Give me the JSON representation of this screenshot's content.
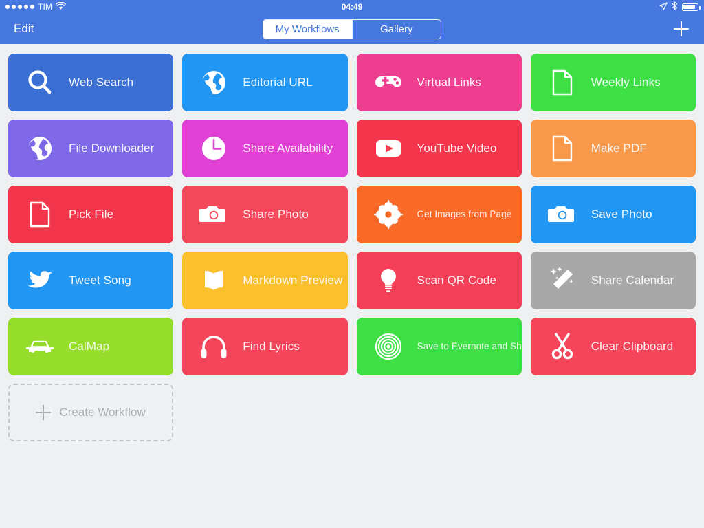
{
  "status_bar": {
    "signal_dots": 5,
    "carrier": "TIM",
    "wifi_icon": "wifi-icon",
    "time": "04:49",
    "location_icon": "location-arrow-icon",
    "bluetooth_icon": "bluetooth-icon",
    "battery_icon": "battery-icon"
  },
  "nav": {
    "edit_label": "Edit",
    "add_icon": "plus-icon",
    "segments": [
      {
        "label": "My Workflows",
        "active": true
      },
      {
        "label": "Gallery",
        "active": false
      }
    ]
  },
  "colors": {
    "nav_bar": "#4778e0",
    "page_background": "#eff0f2",
    "create_border": "#c3c7cd",
    "create_text": "#a9aeb5"
  },
  "workflows": [
    {
      "label": "Web Search",
      "icon": "magnifier-icon",
      "color": "#3b6fd4",
      "small": false
    },
    {
      "label": "Editorial URL",
      "icon": "globe-icon",
      "color": "#2196f3",
      "small": false
    },
    {
      "label": "Virtual Links",
      "icon": "gamepad-icon",
      "color": "#ed3e8f",
      "small": false
    },
    {
      "label": "Weekly Links",
      "icon": "document-icon",
      "color": "#3ee046",
      "small": false
    },
    {
      "label": "File Downloader",
      "icon": "globe-icon",
      "color": "#8069e8",
      "small": false
    },
    {
      "label": "Share Availability",
      "icon": "clock-icon",
      "color": "#e040d4",
      "small": false
    },
    {
      "label": "YouTube Video",
      "icon": "play-icon",
      "color": "#f4364c",
      "small": false
    },
    {
      "label": "Make PDF",
      "icon": "document-icon",
      "color": "#f9994b",
      "small": false
    },
    {
      "label": "Pick File",
      "icon": "document-icon",
      "color": "#f4364c",
      "small": false
    },
    {
      "label": "Share Photo",
      "icon": "camera-icon",
      "color": "#f4495a",
      "small": false
    },
    {
      "label": "Get Images from Page",
      "icon": "flower-gear-icon",
      "color": "#f96a28",
      "small": true
    },
    {
      "label": "Save Photo",
      "icon": "camera-icon",
      "color": "#2196f3",
      "small": false
    },
    {
      "label": "Tweet Song",
      "icon": "twitter-bird-icon",
      "color": "#2196f3",
      "small": false
    },
    {
      "label": "Markdown Preview",
      "icon": "open-book-icon",
      "color": "#fbc02d",
      "small": false
    },
    {
      "label": "Scan QR Code",
      "icon": "lightbulb-icon",
      "color": "#f43f58",
      "small": false
    },
    {
      "label": "Share Calendar",
      "icon": "magic-wand-icon",
      "color": "#a8a8a8",
      "small": false
    },
    {
      "label": "CalMap",
      "icon": "car-icon",
      "color": "#96dd2b",
      "small": false
    },
    {
      "label": "Find Lyrics",
      "icon": "headphones-icon",
      "color": "#f4455a",
      "small": false
    },
    {
      "label": "Save to Evernote and Share",
      "icon": "target-rings-icon",
      "color": "#3ee046",
      "small": true
    },
    {
      "label": "Clear Clipboard",
      "icon": "scissors-icon",
      "color": "#f4455a",
      "small": false
    }
  ],
  "create_workflow": {
    "label": "Create Workflow",
    "icon": "plus-icon"
  }
}
